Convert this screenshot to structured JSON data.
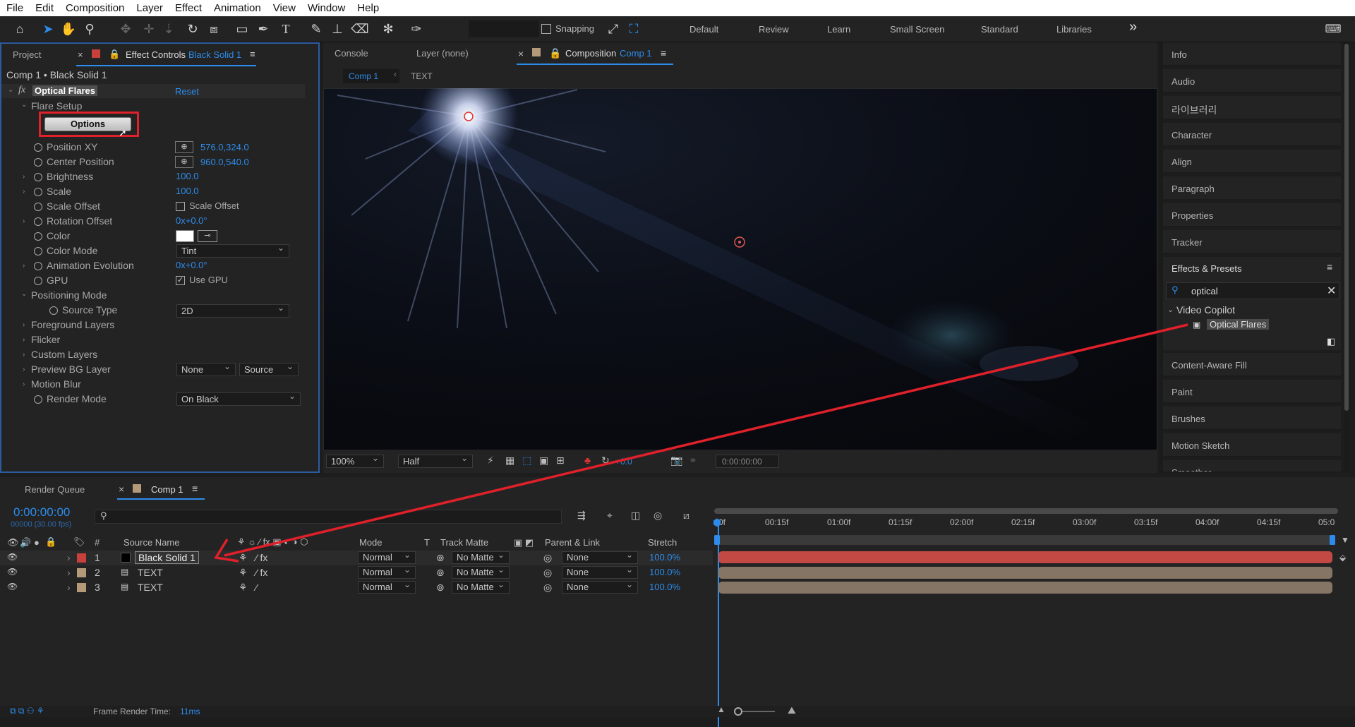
{
  "menubar": [
    "File",
    "Edit",
    "Composition",
    "Layer",
    "Effect",
    "Animation",
    "View",
    "Window",
    "Help"
  ],
  "toolbar": {
    "snapping": "Snapping",
    "workspaces": [
      "Default",
      "Review",
      "Learn",
      "Small Screen",
      "Standard",
      "Libraries"
    ],
    "more": "»"
  },
  "effect_panel": {
    "tab_project": "Project",
    "tab_effect_controls": "Effect Controls",
    "tab_layer": "Black Solid 1",
    "breadcrumb": "Comp 1 • Black Solid 1",
    "effect_name": "Optical Flares",
    "reset": "Reset",
    "flare_setup": "Flare Setup",
    "options_button": "Options",
    "properties": [
      {
        "label": "Position XY",
        "value": "576.0,324.0"
      },
      {
        "label": "Center Position",
        "value": "960.0,540.0"
      },
      {
        "label": "Brightness",
        "value": "100.0"
      },
      {
        "label": "Scale",
        "value": "100.0"
      },
      {
        "label": "Scale Offset",
        "value": "Scale Offset"
      },
      {
        "label": "Rotation Offset",
        "value": "0x+0.0°"
      },
      {
        "label": "Color",
        "value": ""
      },
      {
        "label": "Color Mode",
        "value": "Tint"
      },
      {
        "label": "Animation Evolution",
        "value": "0x+0.0°"
      },
      {
        "label": "GPU",
        "value": "Use GPU"
      }
    ],
    "positioning_mode": "Positioning Mode",
    "source_type_label": "Source Type",
    "source_type_value": "2D",
    "groups": [
      "Foreground Layers",
      "Flicker",
      "Custom Layers"
    ],
    "preview_bg_label": "Preview BG Layer",
    "preview_bg_value": "None",
    "preview_bg_source": "Source",
    "motion_blur": "Motion Blur",
    "render_mode_label": "Render Mode",
    "render_mode_value": "On Black"
  },
  "comp_panel": {
    "tab_console": "Console",
    "tab_layer": "Layer (none)",
    "tab_composition": "Composition",
    "tab_comp_name": "Comp 1",
    "sub_comp": "Comp 1",
    "sub_text": "TEXT",
    "zoom": "100%",
    "resolution": "Half",
    "exposure": "+0.0",
    "timecode": "0:00:00:00"
  },
  "right_panel": {
    "items_top": [
      "Info",
      "Audio",
      "라이브러리",
      "Character",
      "Align",
      "Paragraph",
      "Properties",
      "Tracker"
    ],
    "effects_presets": "Effects & Presets",
    "search_value": "optical",
    "folder": "Video Copilot",
    "result": "Optical Flares",
    "items_bottom": [
      "Content-Aware Fill",
      "Paint",
      "Brushes",
      "Motion Sketch",
      "Smoother"
    ]
  },
  "timeline": {
    "tab_render_queue": "Render Queue",
    "tab_comp": "Comp 1",
    "timecode": "0:00:00:00",
    "frames_fps": "00000 (30.00 fps)",
    "columns": {
      "num": "#",
      "source": "Source Name",
      "mode": "Mode",
      "t": "T",
      "track_matte": "Track Matte",
      "parent": "Parent & Link",
      "stretch": "Stretch"
    },
    "ruler": [
      "0f",
      "00:15f",
      "01:00f",
      "01:15f",
      "02:00f",
      "02:15f",
      "03:00f",
      "03:15f",
      "04:00f",
      "04:15f",
      "05:0"
    ],
    "layers": [
      {
        "num": "1",
        "name": "Black Solid 1",
        "mode": "Normal",
        "matte": "No Matte",
        "parent": "None",
        "stretch": "100.0%",
        "color": "#c9403b"
      },
      {
        "num": "2",
        "name": "TEXT",
        "mode": "Normal",
        "matte": "No Matte",
        "parent": "None",
        "stretch": "100.0%",
        "color": "#b59a7a"
      },
      {
        "num": "3",
        "name": "TEXT",
        "mode": "Normal",
        "matte": "No Matte",
        "parent": "None",
        "stretch": "100.0%",
        "color": "#b59a7a"
      }
    ],
    "frame_render_label": "Frame Render Time:",
    "frame_render_value": "11ms"
  },
  "colors": {
    "accent": "#2d8ceb",
    "annotation": "#e0202a",
    "solid_bar": "#c34a44",
    "text_bar": "#857564"
  }
}
